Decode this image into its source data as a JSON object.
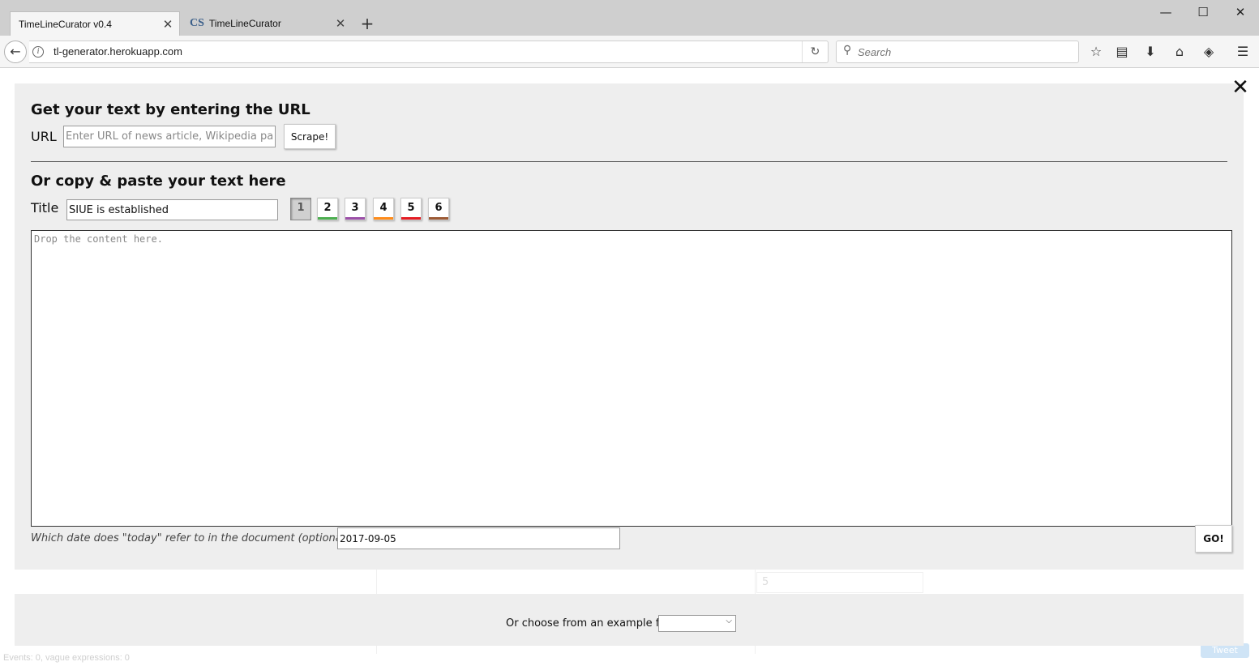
{
  "browser": {
    "tabs": [
      {
        "label": "TimeLineCurator v0.4",
        "active": true
      },
      {
        "label": "TimeLineCurator",
        "active": false,
        "favicon": "CS"
      }
    ],
    "url": "tl-generator.herokuapp.com",
    "search_placeholder": "Search"
  },
  "modal": {
    "url_heading": "Get your text by entering the URL",
    "url_label": "URL",
    "url_placeholder": "Enter URL of news article, Wikipedia page",
    "scrape_label": "Scrape!",
    "paste_heading": "Or copy & paste your text here",
    "title_label": "Title",
    "title_value": "SIUE is established",
    "color_buttons": [
      {
        "label": "1",
        "color": "#b0c4de",
        "selected": true
      },
      {
        "label": "2",
        "color": "#4caf50",
        "selected": false
      },
      {
        "label": "3",
        "color": "#9c4fa8",
        "selected": false
      },
      {
        "label": "4",
        "color": "#ff8c1a",
        "selected": false
      },
      {
        "label": "5",
        "color": "#e51c23",
        "selected": false
      },
      {
        "label": "6",
        "color": "#9c5a35",
        "selected": false
      }
    ],
    "content_placeholder": "Drop the content here.",
    "date_label": "Which date does \"today\" refer to in the document (optional):",
    "date_value": "2017-09-05",
    "go_label": "GO!"
  },
  "example": {
    "label": "Or choose from an example file",
    "selected": ""
  },
  "status": {
    "text": "Events: 0, vague expressions: 0"
  },
  "background": {
    "ghost_input_value": "5",
    "tweet_label": "Tweet"
  }
}
